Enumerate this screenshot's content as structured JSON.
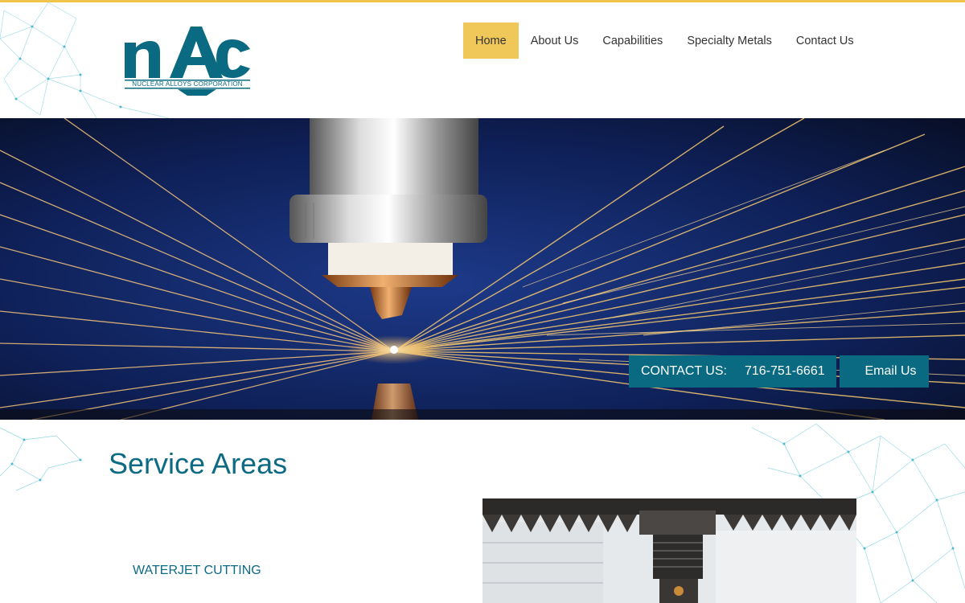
{
  "header": {
    "logo": {
      "mark": "nAc",
      "subtitle": "NUCLEAR ALLOYS CORPORATION"
    },
    "nav": [
      {
        "label": "Home",
        "active": true
      },
      {
        "label": "About Us",
        "active": false
      },
      {
        "label": "Capabilities",
        "active": false
      },
      {
        "label": "Specialty Metals",
        "active": false
      },
      {
        "label": "Contact Us",
        "active": false
      }
    ]
  },
  "hero": {
    "contact_label": "CONTACT US:",
    "phone": "716-751-6661",
    "email_label": "Email Us"
  },
  "main": {
    "title": "Service Areas",
    "services": [
      "WATERJET CUTTING"
    ]
  },
  "colors": {
    "accent_yellow": "#f0c85a",
    "brand_teal": "#0a6a82"
  }
}
